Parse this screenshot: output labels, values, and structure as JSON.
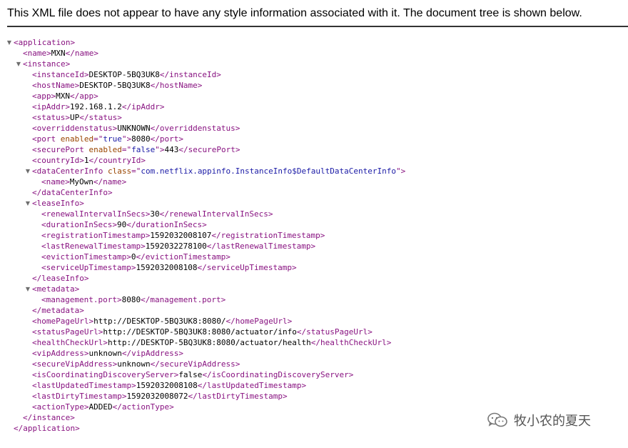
{
  "info_bar": {
    "message": "This XML file does not appear to have any style information associated with it. The document tree is shown below."
  },
  "tree": {
    "lines": [
      {
        "indent": 0,
        "toggle": true,
        "parts": [
          [
            "t",
            "<application>"
          ]
        ]
      },
      {
        "indent": 1,
        "toggle": false,
        "parts": [
          [
            "t",
            "<name>"
          ],
          [
            "x",
            "MXN"
          ],
          [
            "t",
            "</name>"
          ]
        ]
      },
      {
        "indent": 1,
        "toggle": true,
        "parts": [
          [
            "t",
            "<instance>"
          ]
        ]
      },
      {
        "indent": 2,
        "toggle": false,
        "parts": [
          [
            "t",
            "<instanceId>"
          ],
          [
            "x",
            "DESKTOP-5BQ3UK8"
          ],
          [
            "t",
            "</instanceId>"
          ]
        ]
      },
      {
        "indent": 2,
        "toggle": false,
        "parts": [
          [
            "t",
            "<hostName>"
          ],
          [
            "x",
            "DESKTOP-5BQ3UK8"
          ],
          [
            "t",
            "</hostName>"
          ]
        ]
      },
      {
        "indent": 2,
        "toggle": false,
        "parts": [
          [
            "t",
            "<app>"
          ],
          [
            "x",
            "MXN"
          ],
          [
            "t",
            "</app>"
          ]
        ]
      },
      {
        "indent": 2,
        "toggle": false,
        "parts": [
          [
            "t",
            "<ipAddr>"
          ],
          [
            "x",
            "192.168.1.2"
          ],
          [
            "t",
            "</ipAddr>"
          ]
        ]
      },
      {
        "indent": 2,
        "toggle": false,
        "parts": [
          [
            "t",
            "<status>"
          ],
          [
            "x",
            "UP"
          ],
          [
            "t",
            "</status>"
          ]
        ]
      },
      {
        "indent": 2,
        "toggle": false,
        "parts": [
          [
            "t",
            "<overriddenstatus>"
          ],
          [
            "x",
            "UNKNOWN"
          ],
          [
            "t",
            "</overriddenstatus>"
          ]
        ]
      },
      {
        "indent": 2,
        "toggle": false,
        "parts": [
          [
            "t",
            "<port"
          ],
          [
            "a",
            " enabled"
          ],
          [
            "t",
            "=\""
          ],
          [
            "v",
            "true"
          ],
          [
            "t",
            "\">"
          ],
          [
            "x",
            "8080"
          ],
          [
            "t",
            "</port>"
          ]
        ]
      },
      {
        "indent": 2,
        "toggle": false,
        "parts": [
          [
            "t",
            "<securePort"
          ],
          [
            "a",
            " enabled"
          ],
          [
            "t",
            "=\""
          ],
          [
            "v",
            "false"
          ],
          [
            "t",
            "\">"
          ],
          [
            "x",
            "443"
          ],
          [
            "t",
            "</securePort>"
          ]
        ]
      },
      {
        "indent": 2,
        "toggle": false,
        "parts": [
          [
            "t",
            "<countryId>"
          ],
          [
            "x",
            "1"
          ],
          [
            "t",
            "</countryId>"
          ]
        ]
      },
      {
        "indent": 2,
        "toggle": true,
        "parts": [
          [
            "t",
            "<dataCenterInfo"
          ],
          [
            "a",
            " class"
          ],
          [
            "t",
            "=\""
          ],
          [
            "v",
            "com.netflix.appinfo.InstanceInfo$DefaultDataCenterInfo"
          ],
          [
            "t",
            "\">"
          ]
        ]
      },
      {
        "indent": 3,
        "toggle": false,
        "parts": [
          [
            "t",
            "<name>"
          ],
          [
            "x",
            "MyOwn"
          ],
          [
            "t",
            "</name>"
          ]
        ]
      },
      {
        "indent": 2,
        "toggle": false,
        "parts": [
          [
            "t",
            "</dataCenterInfo>"
          ]
        ]
      },
      {
        "indent": 2,
        "toggle": true,
        "parts": [
          [
            "t",
            "<leaseInfo>"
          ]
        ]
      },
      {
        "indent": 3,
        "toggle": false,
        "parts": [
          [
            "t",
            "<renewalIntervalInSecs>"
          ],
          [
            "x",
            "30"
          ],
          [
            "t",
            "</renewalIntervalInSecs>"
          ]
        ]
      },
      {
        "indent": 3,
        "toggle": false,
        "parts": [
          [
            "t",
            "<durationInSecs>"
          ],
          [
            "x",
            "90"
          ],
          [
            "t",
            "</durationInSecs>"
          ]
        ]
      },
      {
        "indent": 3,
        "toggle": false,
        "parts": [
          [
            "t",
            "<registrationTimestamp>"
          ],
          [
            "x",
            "1592032008107"
          ],
          [
            "t",
            "</registrationTimestamp>"
          ]
        ]
      },
      {
        "indent": 3,
        "toggle": false,
        "parts": [
          [
            "t",
            "<lastRenewalTimestamp>"
          ],
          [
            "x",
            "1592032278100"
          ],
          [
            "t",
            "</lastRenewalTimestamp>"
          ]
        ]
      },
      {
        "indent": 3,
        "toggle": false,
        "parts": [
          [
            "t",
            "<evictionTimestamp>"
          ],
          [
            "x",
            "0"
          ],
          [
            "t",
            "</evictionTimestamp>"
          ]
        ]
      },
      {
        "indent": 3,
        "toggle": false,
        "parts": [
          [
            "t",
            "<serviceUpTimestamp>"
          ],
          [
            "x",
            "1592032008108"
          ],
          [
            "t",
            "</serviceUpTimestamp>"
          ]
        ]
      },
      {
        "indent": 2,
        "toggle": false,
        "parts": [
          [
            "t",
            "</leaseInfo>"
          ]
        ]
      },
      {
        "indent": 2,
        "toggle": true,
        "parts": [
          [
            "t",
            "<metadata>"
          ]
        ]
      },
      {
        "indent": 3,
        "toggle": false,
        "parts": [
          [
            "t",
            "<management.port>"
          ],
          [
            "x",
            "8080"
          ],
          [
            "t",
            "</management.port>"
          ]
        ]
      },
      {
        "indent": 2,
        "toggle": false,
        "parts": [
          [
            "t",
            "</metadata>"
          ]
        ]
      },
      {
        "indent": 2,
        "toggle": false,
        "parts": [
          [
            "t",
            "<homePageUrl>"
          ],
          [
            "x",
            "http://DESKTOP-5BQ3UK8:8080/"
          ],
          [
            "t",
            "</homePageUrl>"
          ]
        ]
      },
      {
        "indent": 2,
        "toggle": false,
        "parts": [
          [
            "t",
            "<statusPageUrl>"
          ],
          [
            "x",
            "http://DESKTOP-5BQ3UK8:8080/actuator/info"
          ],
          [
            "t",
            "</statusPageUrl>"
          ]
        ]
      },
      {
        "indent": 2,
        "toggle": false,
        "parts": [
          [
            "t",
            "<healthCheckUrl>"
          ],
          [
            "x",
            "http://DESKTOP-5BQ3UK8:8080/actuator/health"
          ],
          [
            "t",
            "</healthCheckUrl>"
          ]
        ]
      },
      {
        "indent": 2,
        "toggle": false,
        "parts": [
          [
            "t",
            "<vipAddress>"
          ],
          [
            "x",
            "unknown"
          ],
          [
            "t",
            "</vipAddress>"
          ]
        ]
      },
      {
        "indent": 2,
        "toggle": false,
        "parts": [
          [
            "t",
            "<secureVipAddress>"
          ],
          [
            "x",
            "unknown"
          ],
          [
            "t",
            "</secureVipAddress>"
          ]
        ]
      },
      {
        "indent": 2,
        "toggle": false,
        "parts": [
          [
            "t",
            "<isCoordinatingDiscoveryServer>"
          ],
          [
            "x",
            "false"
          ],
          [
            "t",
            "</isCoordinatingDiscoveryServer>"
          ]
        ]
      },
      {
        "indent": 2,
        "toggle": false,
        "parts": [
          [
            "t",
            "<lastUpdatedTimestamp>"
          ],
          [
            "x",
            "1592032008108"
          ],
          [
            "t",
            "</lastUpdatedTimestamp>"
          ]
        ]
      },
      {
        "indent": 2,
        "toggle": false,
        "parts": [
          [
            "t",
            "<lastDirtyTimestamp>"
          ],
          [
            "x",
            "1592032008072"
          ],
          [
            "t",
            "</lastDirtyTimestamp>"
          ]
        ]
      },
      {
        "indent": 2,
        "toggle": false,
        "parts": [
          [
            "t",
            "<actionType>"
          ],
          [
            "x",
            "ADDED"
          ],
          [
            "t",
            "</actionType>"
          ]
        ]
      },
      {
        "indent": 1,
        "toggle": false,
        "parts": [
          [
            "t",
            "</instance>"
          ]
        ]
      },
      {
        "indent": 0,
        "toggle": false,
        "parts": [
          [
            "t",
            "</application>"
          ]
        ]
      }
    ]
  },
  "watermark": {
    "text": "牧小农的夏天",
    "icon": "wechat-icon"
  },
  "colors": {
    "tag": "#881280",
    "attribute": "#994500",
    "attribute_value": "#1a1aa6",
    "text": "#000000",
    "toggle": "#6e6e6e"
  }
}
